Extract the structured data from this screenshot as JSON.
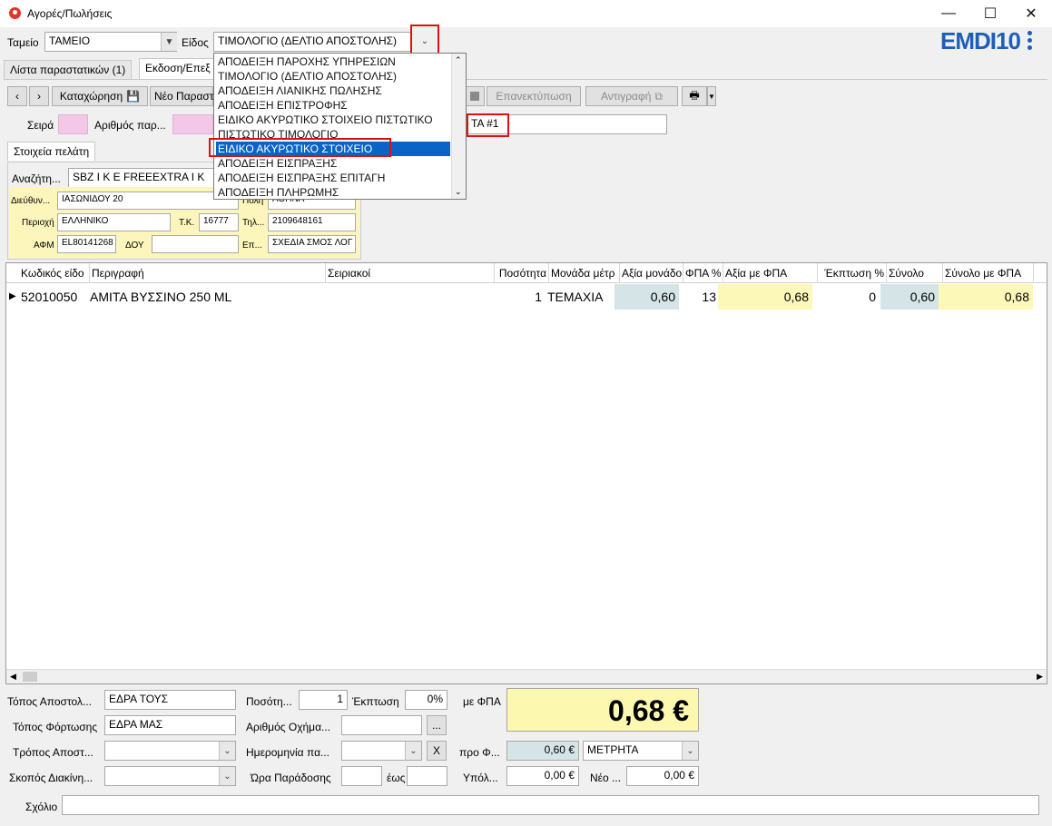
{
  "window": {
    "title": "Αγορές/Πωλήσεις",
    "minimize_icon": "—",
    "maximize_icon": "☐",
    "close_icon": "✕"
  },
  "header": {
    "tameio_label": "Ταμείο",
    "tameio_value": "ΤΑΜΕΙΟ",
    "eidos_label": "Είδος",
    "eidos_value": "ΤΙΜΟΛΟΓΙΟ (ΔΕΛΤΙΟ ΑΠΟΣΤΟΛΗΣ)",
    "logo": "EMDI10",
    "accent_color": "#1c5fb8"
  },
  "tabs": [
    {
      "label": "Λίστα παραστατικών (1)"
    },
    {
      "label": "Εκδοση/Επεξ"
    }
  ],
  "toolbar": {
    "prev_icon": "‹",
    "next_icon": "›",
    "register_label": "Καταχώρηση",
    "new_label": "Νέο Παραστ",
    "reprint_label": "Επανεκτύπωση",
    "copy_label": "Αντιγραφή"
  },
  "doc": {
    "seira_label": "Σειρά",
    "seira_value": "",
    "arithmos_label": "Αριθμός παρ...",
    "arithmos_value": "",
    "ta_value": "ΤΑ #1"
  },
  "customer": {
    "tab_label": "Στοιχεία πελάτη",
    "search_label": "Αναζήτη...",
    "search_value": "SBZ I K E  FREEEXTRA I K",
    "address_label": "Διεύθυν...",
    "address_value": "ΙΑΣΩΝΙΔΟΥ 20",
    "city_label": "Πόλη",
    "city_value": "ΑΘΗΝΑ",
    "area_label": "Περιοχή",
    "area_value": "ΕΛΛΗΝΙΚΟ",
    "tk_label": "Τ.Κ.",
    "tk_value": "16777",
    "phone_label": "Τηλ...",
    "phone_value": "2109648161",
    "afm_label": "ΑΦΜ",
    "afm_value": "EL80141268",
    "doy_label": "ΔΟΥ",
    "doy_value": "",
    "job_label": "Επ...",
    "job_value": "ΣΧΕΔΙΑ ΣΜΟΣ ΛΟΓ"
  },
  "dropdown": {
    "items": [
      "ΑΠΟΔΕΙΞΗ ΠΑΡΟΧΗΣ ΥΠΗΡΕΣΙΩΝ",
      "ΤΙΜΟΛΟΓΙΟ (ΔΕΛΤΙΟ ΑΠΟΣΤΟΛΗΣ)",
      "ΑΠΟΔΕΙΞΗ ΛΙΑΝΙΚΗΣ ΠΩΛΗΣΗΣ",
      "ΑΠΟΔΕΙΞΗ ΕΠΙΣΤΡΟΦΗΣ",
      "ΕΙΔΙΚΟ ΑΚΥΡΩΤΙΚΟ ΣΤΟΙΧΕΙΟ ΠΙΣΤΩΤΙΚΟ",
      "ΠΙΣΤΩΤΙΚΟ ΤΙΜΟΛΟΓΙΟ",
      "ΕΙΔΙΚΟ ΑΚΥΡΩΤΙΚΟ ΣΤΟΙΧΕΙΟ",
      "ΑΠΟΔΕΙΞΗ ΕΙΣΠΡΑΞΗΣ",
      "ΑΠΟΔΕΙΞΗ ΕΙΣΠΡΑΞΗΣ ΕΠΙΤΑΓΗ",
      "ΑΠΟΔΕΙΞΗ ΠΛΗΡΩΜΗΣ"
    ],
    "selected_index": 6
  },
  "grid": {
    "headers": [
      "Κωδικός είδο",
      "Περιγραφή",
      "Σειριακοί",
      "Ποσότητα",
      "Μονάδα μέτρ",
      "Αξία μονάδο",
      "ΦΠΑ %",
      "Αξία με ΦΠΑ",
      "Έκπτωση %",
      "Σύνολο",
      "Σύνολο με ΦΠΑ"
    ],
    "rows": [
      [
        "52010050",
        "ΑΜΙΤΑ ΒΥΣΣΙΝΟ 250 ML",
        "",
        "1",
        "ΤΕΜΑΧΙΑ",
        "0,60",
        "13",
        "0,68",
        "0",
        "0,60",
        "0,68"
      ]
    ]
  },
  "footer": {
    "topos_apostolis_label": "Τόπος Αποστολ...",
    "topos_apostolis_value": "ΕΔΡΑ ΤΟΥΣ",
    "topos_fortosis_label": "Τόπος Φόρτωσης",
    "topos_fortosis_value": "ΕΔΡΑ ΜΑΣ",
    "tropos_label": "Τρόπος Αποστ...",
    "skopos_label": "Σκοπός Διακίνη...",
    "posotita_label": "Ποσότη...",
    "posotita_value": "1",
    "ekptosi_label": "Έκπτωση",
    "ekptosi_value": "0%",
    "oxima_label": "Αριθμός Οχήμα...",
    "browse_label": "...",
    "imerominia_label": "Ημερομηνία πα...",
    "clear_label": "X",
    "ora_label": "Ώρα Παράδοσης",
    "eos_label": "έως",
    "me_fpa_label": "με ΦΠΑ",
    "total": "0,68 €",
    "pro_label": "προ Φ...",
    "pro_value": "0,60 €",
    "payment": "ΜΕΤΡΗΤΑ",
    "ypol_label": "Υπόλ...",
    "ypol_value": "0,00 €",
    "neo_label": "Νέο ...",
    "neo_value": "0,00 €",
    "comment_label": "Σχόλιο"
  }
}
